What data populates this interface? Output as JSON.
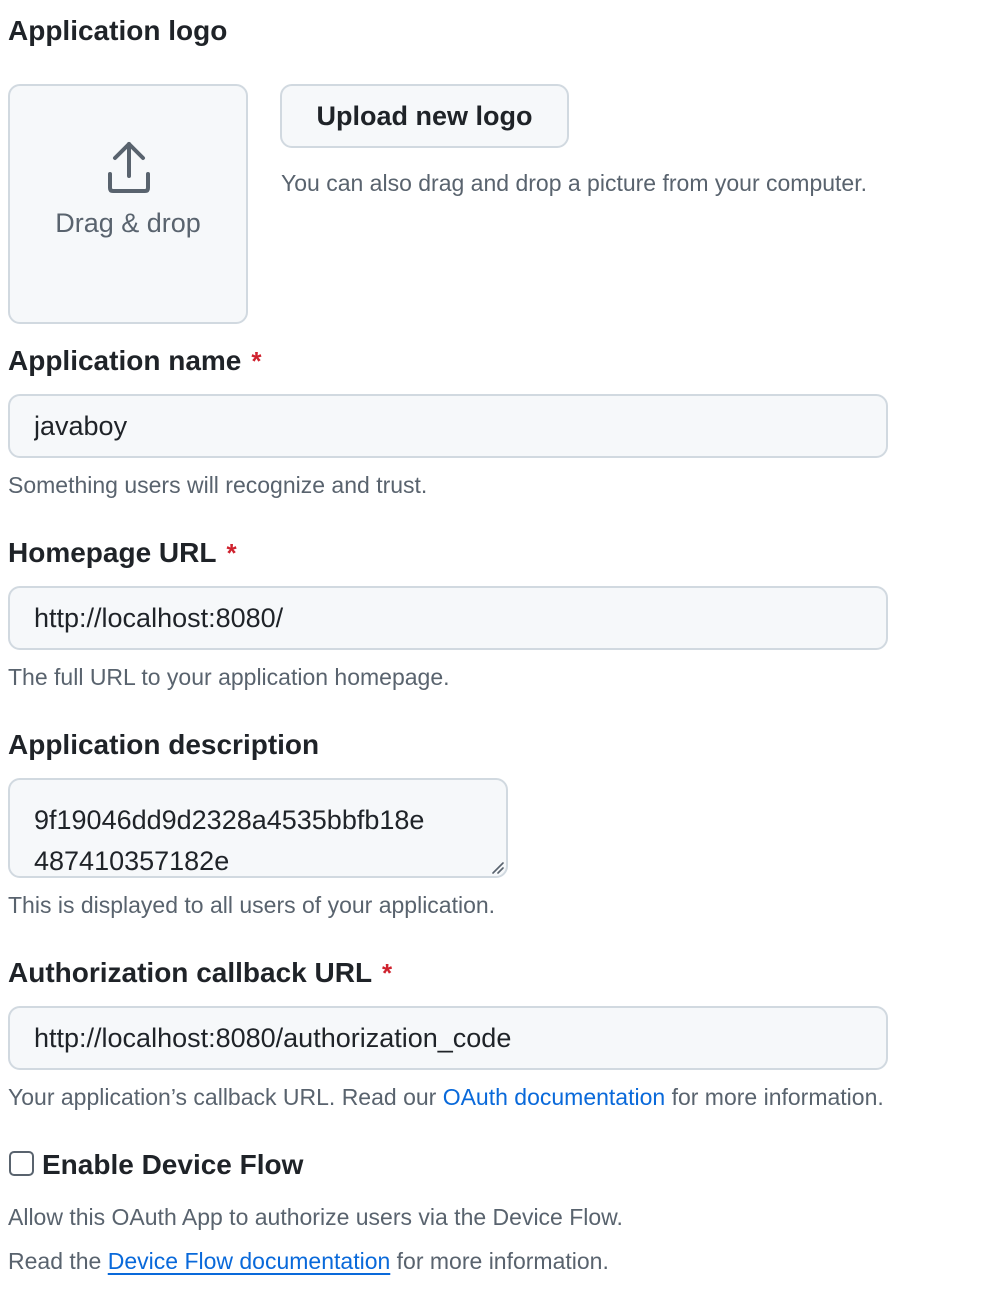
{
  "logo": {
    "label": "Application logo",
    "dropzone_text": "Drag & drop",
    "upload_button": "Upload new logo",
    "hint": "You can also drag and drop a picture from your computer."
  },
  "name": {
    "label": "Application name",
    "required_mark": "*",
    "value": "javaboy",
    "hint": "Something users will recognize and trust."
  },
  "homepage": {
    "label": "Homepage URL",
    "required_mark": "*",
    "value": "http://localhost:8080/",
    "hint": "The full URL to your application homepage."
  },
  "description": {
    "label": "Application description",
    "value": "9f19046dd9d2328a4535bbfb18e\n487410357182e",
    "hint": "This is displayed to all users of your application."
  },
  "callback": {
    "label": "Authorization callback URL",
    "required_mark": "*",
    "value": "http://localhost:8080/authorization_code",
    "hint_prefix": "Your application’s callback URL. Read our ",
    "hint_link": "OAuth documentation",
    "hint_suffix": " for more information."
  },
  "device_flow": {
    "label": "Enable Device Flow",
    "checked": false,
    "hint": "Allow this OAuth App to authorize users via the Device Flow.",
    "docs_prefix": "Read the ",
    "docs_link": "Device Flow documentation",
    "docs_suffix": " for more information."
  },
  "icons": {
    "upload": "upload-icon",
    "resize": "resize-grip-icon"
  },
  "colors": {
    "required": "#cf222e",
    "link": "#0969da",
    "input_bg": "#f6f8fa",
    "border": "#d1d9e0",
    "muted": "#59636e"
  }
}
